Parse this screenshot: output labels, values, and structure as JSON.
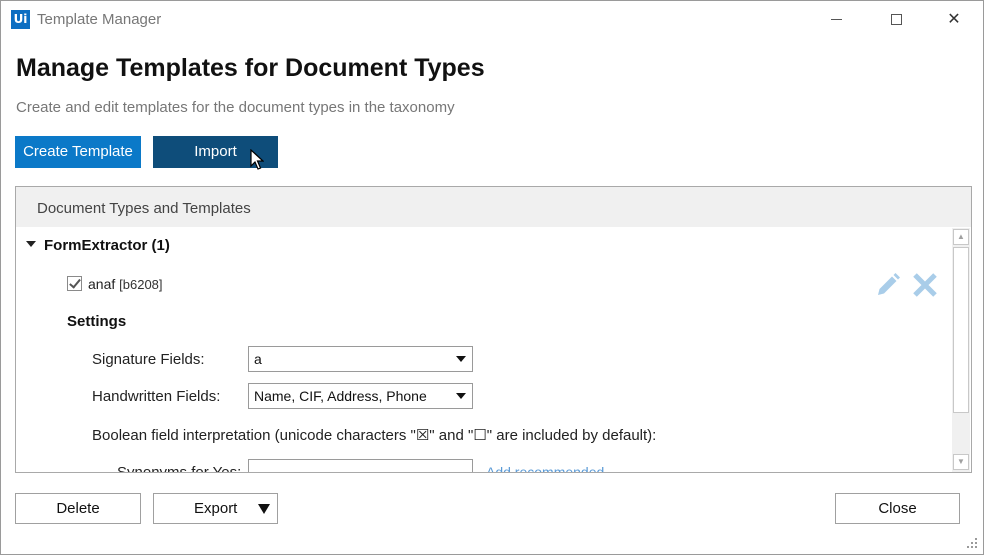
{
  "window": {
    "logo_text": "Ui",
    "title": "Template Manager",
    "minimize_icon": "minimize-icon",
    "maximize_icon": "maximize-icon",
    "close_icon": "close-icon",
    "close_glyph": "✕"
  },
  "page": {
    "title": "Manage Templates for Document Types",
    "subtitle": "Create and edit templates for the document types in the taxonomy"
  },
  "toolbar": {
    "create_label": "Create Template",
    "import_label": "Import"
  },
  "panel": {
    "header": "Document Types and Templates",
    "group": {
      "label": "FormExtractor (1)",
      "expanded": true
    },
    "template": {
      "name": "anaf",
      "id": "[b6208]",
      "checked": true,
      "edit_icon": "pencil-icon",
      "delete_icon": "x-icon"
    },
    "settings": {
      "label": "Settings",
      "signature_label": "Signature Fields:",
      "signature_value": "a",
      "handwritten_label": "Handwritten Fields:",
      "handwritten_value": "Name, CIF, Address, Phone",
      "boolean_label": "Boolean field interpretation (unicode characters \"☒\" and \"☐\" are included by default):",
      "synonyms_yes_label": "Synonyms for Yes:",
      "synonyms_yes_value": "",
      "add_recommended": "Add recommended"
    }
  },
  "footer": {
    "delete_label": "Delete",
    "export_label": "Export",
    "close_label": "Close"
  },
  "colors": {
    "primary": "#0b79c8",
    "primary_pressed": "#0e4d7a",
    "icon_muted": "#a9cde9",
    "link": "#5a9ad6"
  }
}
